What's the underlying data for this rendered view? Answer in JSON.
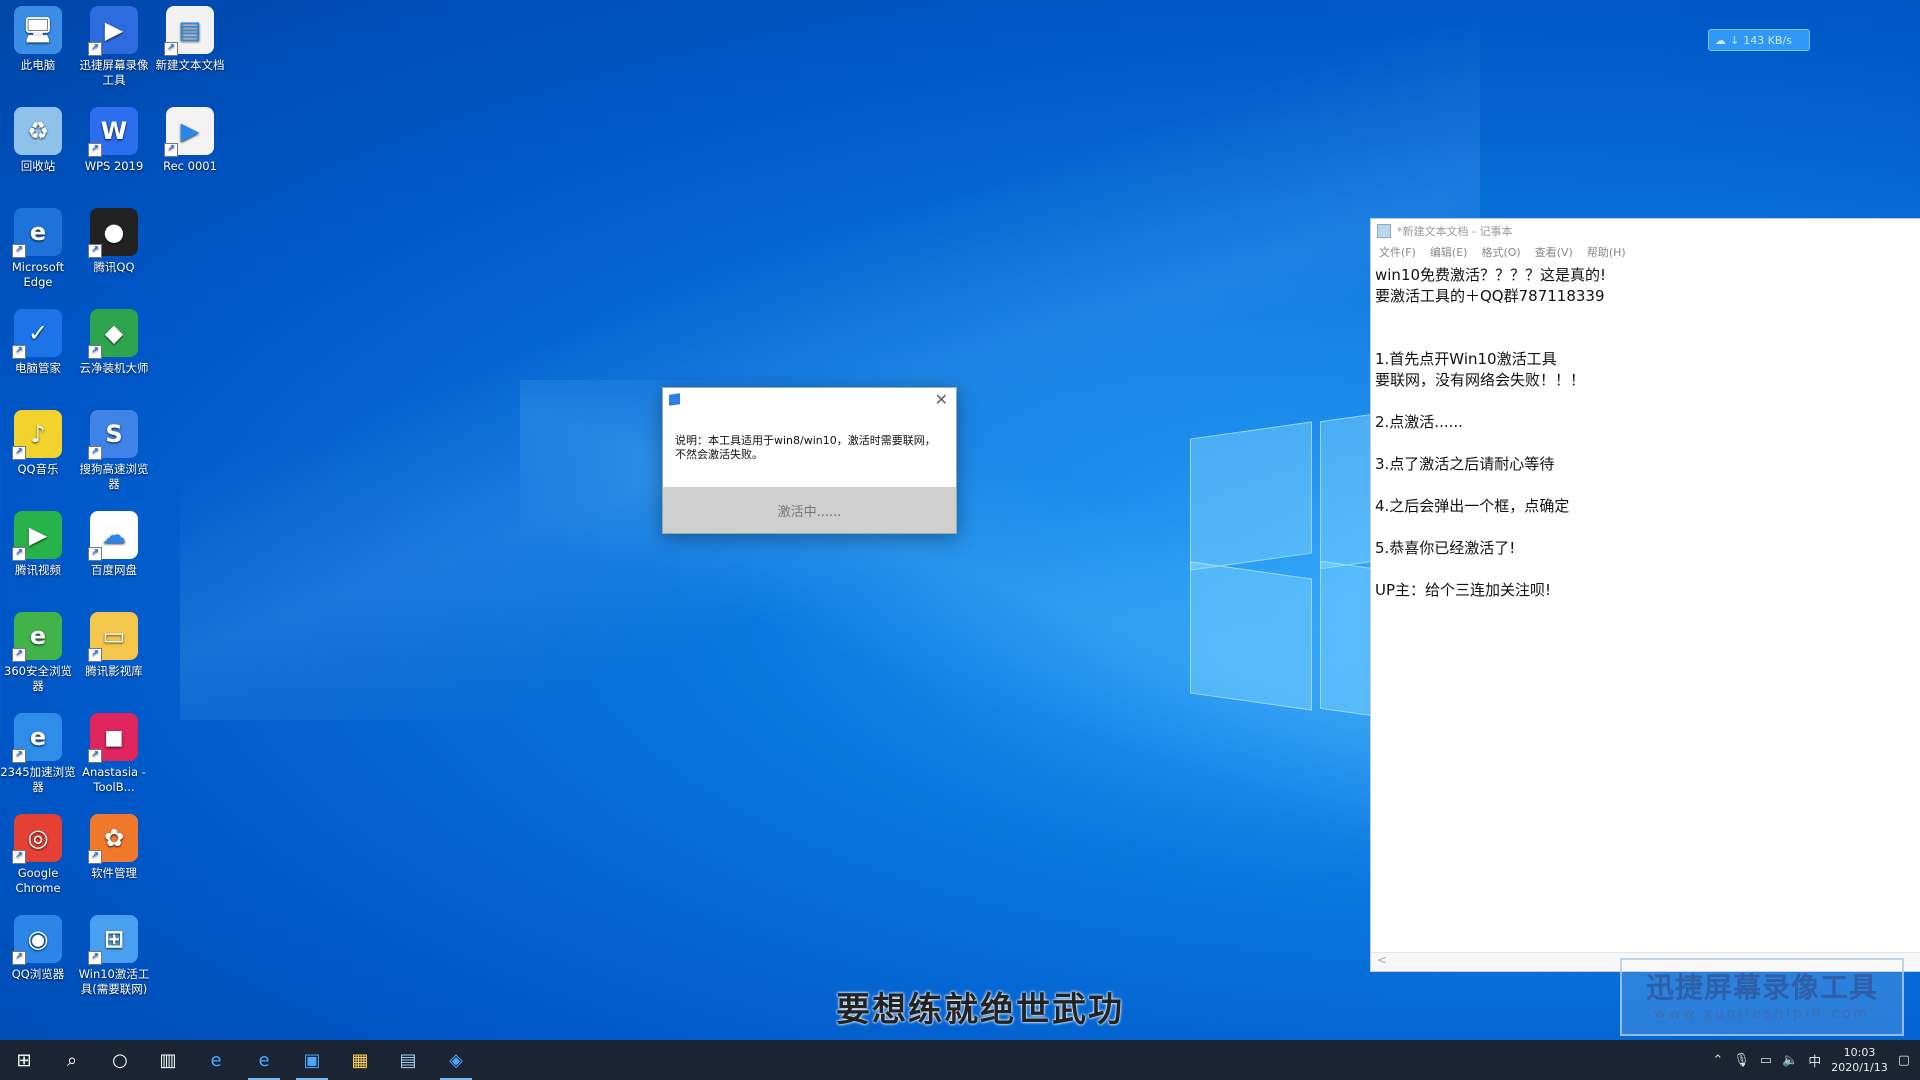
{
  "desktop_icons": [
    {
      "label": "此电脑",
      "icon": "computer-icon",
      "color": "#3a8ee6"
    },
    {
      "label": "迅捷屏幕录像工具",
      "icon": "screen-recorder-icon",
      "color": "#2d6cdf"
    },
    {
      "label": "新建文本文档",
      "icon": "text-document-icon",
      "color": "#f2f2f2"
    },
    {
      "label": "回收站",
      "icon": "recycle-bin-icon",
      "color": "#8fc2ea"
    },
    {
      "label": "WPS 2019",
      "icon": "wps-icon",
      "color": "#2b6ef0"
    },
    {
      "label": "Rec 0001",
      "icon": "video-file-icon",
      "color": "#f3f3f3"
    },
    {
      "label": "Microsoft Edge",
      "icon": "edge-icon",
      "color": "#1d73d8"
    },
    {
      "label": "腾讯QQ",
      "icon": "qq-penguin-icon",
      "color": "#222222"
    },
    {
      "label": "电脑管家",
      "icon": "shield-icon",
      "color": "#1c74e8"
    },
    {
      "label": "云净装机大师",
      "icon": "green-shield-icon",
      "color": "#2ea44f"
    },
    {
      "label": "QQ音乐",
      "icon": "qq-music-icon",
      "color": "#f2d22c"
    },
    {
      "label": "搜狗高速浏览器",
      "icon": "sogou-browser-icon",
      "color": "#3f83e6"
    },
    {
      "label": "腾讯视频",
      "icon": "tencent-video-icon",
      "color": "#27b24a"
    },
    {
      "label": "百度网盘",
      "icon": "baidu-netdisk-icon",
      "color": "#ffffff"
    },
    {
      "label": "360安全浏览器",
      "icon": "360-browser-icon",
      "color": "#41b34a"
    },
    {
      "label": "腾讯影视库",
      "icon": "folder-icon",
      "color": "#f3c64c"
    },
    {
      "label": "2345加速浏览器",
      "icon": "ie-browser-icon",
      "color": "#2e8de8"
    },
    {
      "label": "Anastasia -ToolB...",
      "icon": "cube-icon",
      "color": "#e0245e"
    },
    {
      "label": "Google Chrome",
      "icon": "chrome-icon",
      "color": "#e44134"
    },
    {
      "label": "软件管理",
      "icon": "software-manager-icon",
      "color": "#f0792b"
    },
    {
      "label": "QQ浏览器",
      "icon": "qq-browser-icon",
      "color": "#2b86e8"
    },
    {
      "label": "Win10激活工具(需要联网)",
      "icon": "windows-flag-icon",
      "color": "#4aa0f0"
    }
  ],
  "netspeed": {
    "text": "143 KB/s"
  },
  "dialog": {
    "message": "说明：本工具适用于win8/win10，激活时需要联网，不然会激活失败。",
    "button_label": "激活中......"
  },
  "notepad": {
    "title": "*新建文本文档 - 记事本",
    "menu": [
      "文件(F)",
      "编辑(E)",
      "格式(O)",
      "查看(V)",
      "帮助(H)"
    ],
    "content": "win10免费激活？？？？这是真的!\n要激活工具的＋QQ群787118339\n\n\n1.首先点开Win10激活工具\n要联网，没有网络会失败！！！\n\n2.点激活......\n\n3.点了激活之后请耐心等待\n\n4.之后会弹出一个框，点确定\n\n5.恭喜你已经激活了!\n\nUP主：给个三连加关注呗!",
    "scroll_arrow": "<"
  },
  "subtitle": "要想练就绝世武功",
  "watermark": {
    "title": "迅捷屏幕录像工具",
    "url": "www.xunjieshipin.com"
  },
  "taskbar": {
    "items": [
      "start-icon",
      "search-icon",
      "cortana-icon",
      "task-view-icon",
      "edge-icon",
      "ie-icon",
      "screen-recorder-icon",
      "store-icon",
      "notepad-icon",
      "activation-tool-icon"
    ],
    "time": "10:03",
    "date": "2020/1/13",
    "ime": "中"
  }
}
